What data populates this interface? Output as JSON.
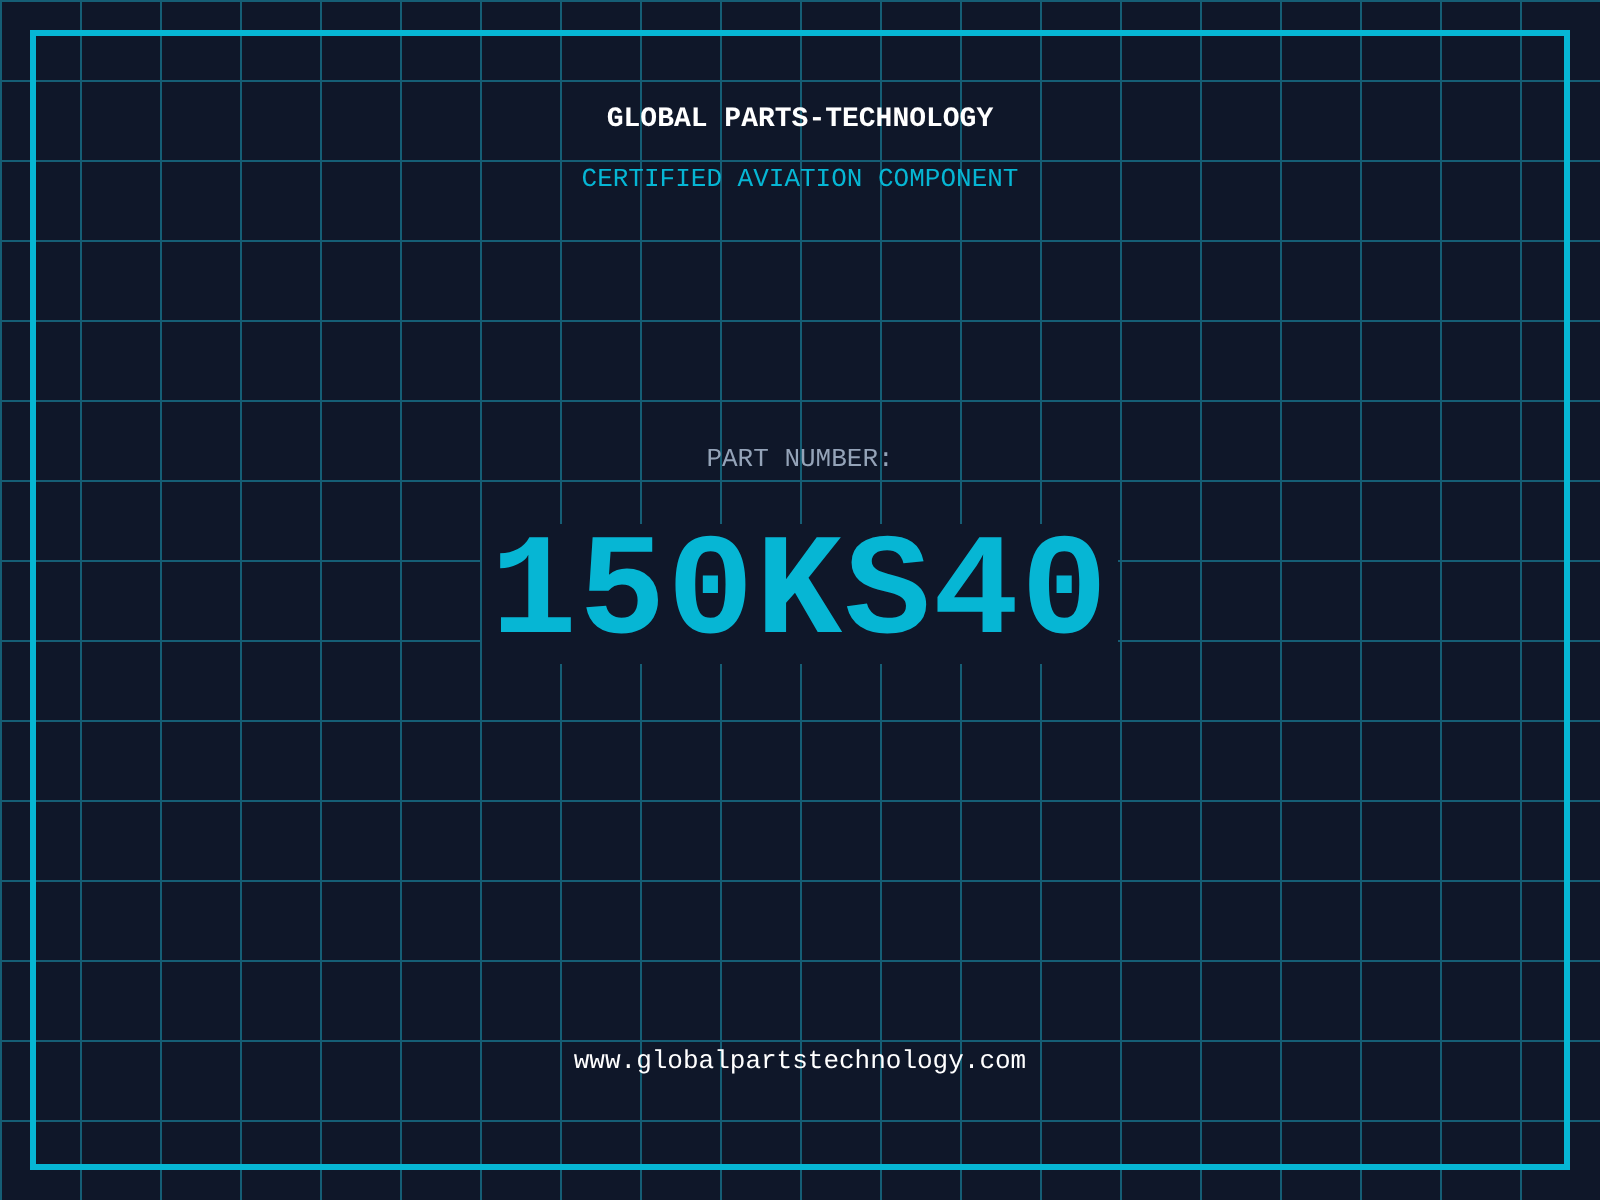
{
  "header": {
    "title": "GLOBAL PARTS-TECHNOLOGY",
    "subtitle": "CERTIFIED AVIATION COMPONENT"
  },
  "part": {
    "label": "PART NUMBER:",
    "number": "150KS40"
  },
  "footer": {
    "url": "www.globalpartstechnology.com"
  }
}
